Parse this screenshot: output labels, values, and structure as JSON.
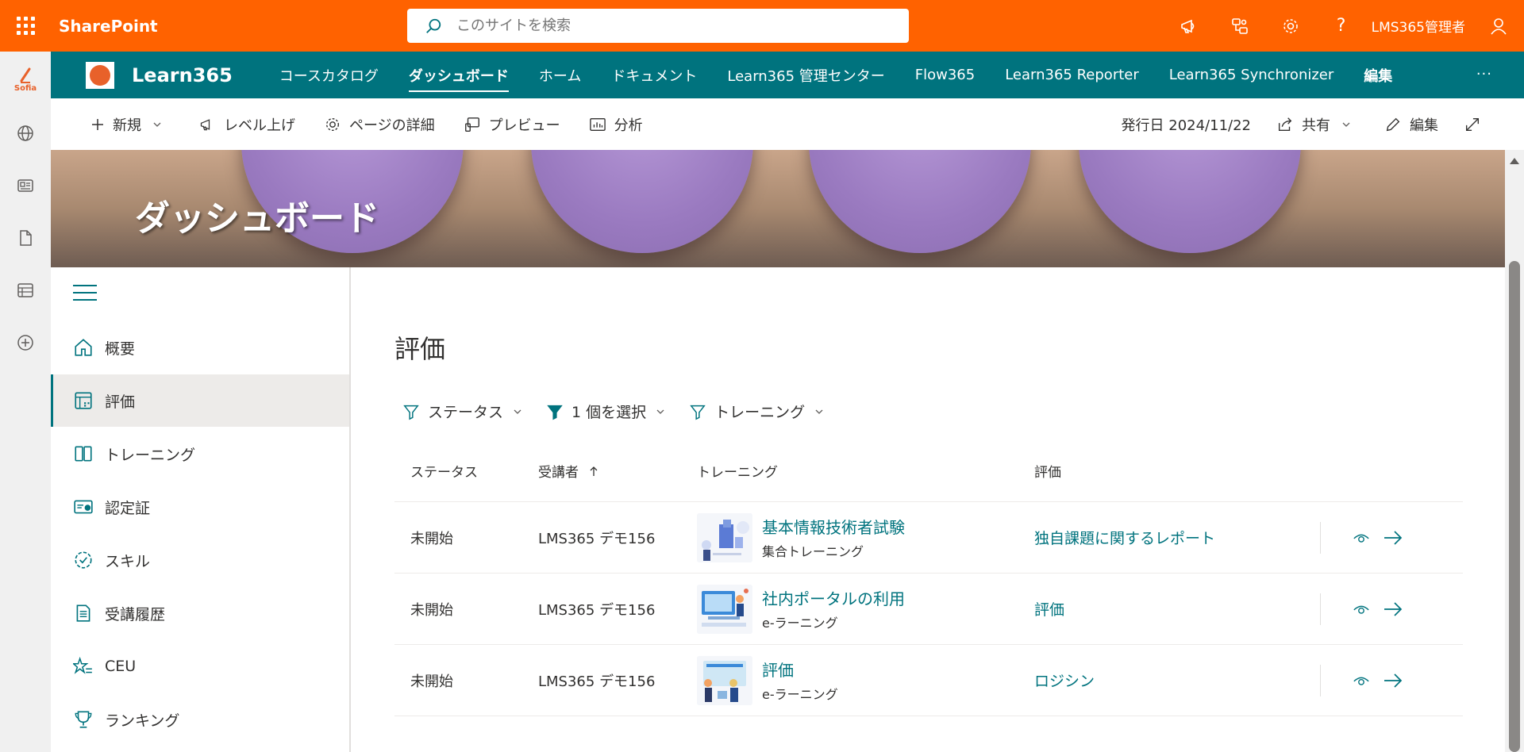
{
  "suite": {
    "brand": "SharePoint",
    "search_placeholder": "このサイトを検索",
    "user": "LMS365管理者",
    "icons": [
      "megaphone-icon",
      "org-icon",
      "settings-icon",
      "help-icon",
      "person-icon"
    ],
    "help_glyph": "?"
  },
  "appbar": {
    "logo_text": "Sofia",
    "icons": [
      "globe-icon",
      "news-icon",
      "file-icon",
      "list-icon",
      "add-icon"
    ]
  },
  "site": {
    "title": "Learn365",
    "nav": [
      {
        "label": "コースカタログ"
      },
      {
        "label": "ダッシュボード"
      },
      {
        "label": "ホーム"
      },
      {
        "label": "ドキュメント"
      },
      {
        "label": "Learn365 管理センター"
      },
      {
        "label": "Flow365"
      },
      {
        "label": "Learn365 Reporter"
      },
      {
        "label": "Learn365 Synchronizer"
      },
      {
        "label": "編集"
      }
    ],
    "active_nav": "ダッシュボード",
    "more": "···"
  },
  "commandbar": {
    "new": "新規",
    "promote": "レベル上げ",
    "page_details": "ページの詳細",
    "preview": "プレビュー",
    "analytics": "分析",
    "published": "発行日 2024/11/22",
    "share": "共有",
    "edit": "編集"
  },
  "banner": {
    "title": "ダッシュボード"
  },
  "leftnav": {
    "items": [
      {
        "label": "概要",
        "icon": "home-icon"
      },
      {
        "label": "評価",
        "icon": "assessment-icon"
      },
      {
        "label": "トレーニング",
        "icon": "book-icon"
      },
      {
        "label": "認定証",
        "icon": "certificate-icon"
      },
      {
        "label": "スキル",
        "icon": "skill-badge-icon"
      },
      {
        "label": "受講履歴",
        "icon": "history-icon"
      },
      {
        "label": "CEU",
        "icon": "star-list-icon"
      },
      {
        "label": "ランキング",
        "icon": "trophy-icon"
      }
    ],
    "active": "評価"
  },
  "main": {
    "title": "評価",
    "filters": [
      {
        "label": "ステータス",
        "active": false
      },
      {
        "label": "1 個を選択",
        "active": true
      },
      {
        "label": "トレーニング",
        "active": false
      }
    ],
    "columns": {
      "status": "ステータス",
      "learner": "受講者",
      "training": "トレーニング",
      "evaluation": "評価"
    },
    "rows": [
      {
        "status": "未開始",
        "learner": "LMS365 デモ156",
        "training_title": "基本情報技術者試験",
        "training_type": "集合トレーニング",
        "evaluation": "独自課題に関するレポート"
      },
      {
        "status": "未開始",
        "learner": "LMS365 デモ156",
        "training_title": "社内ポータルの利用",
        "training_type": "e-ラーニング",
        "evaluation": "評価"
      },
      {
        "status": "未開始",
        "learner": "LMS365 デモ156",
        "training_title": "評価",
        "training_type": "e-ラーニング",
        "evaluation": "ロジシン"
      }
    ]
  },
  "colors": {
    "suitebar": "#ff6200",
    "site_header": "#00737e",
    "accent": "#00737e"
  }
}
